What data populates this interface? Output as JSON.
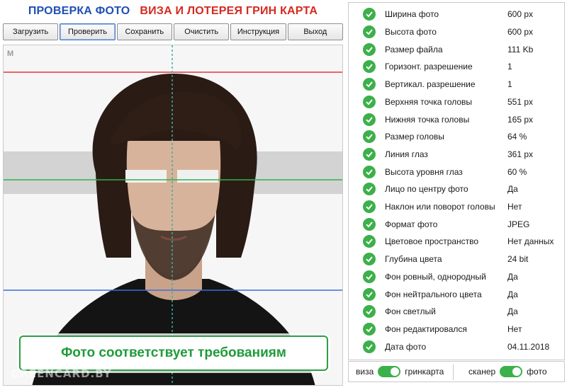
{
  "header": {
    "title_left": "ПРОВЕРКА ФОТО",
    "title_right": "ВИЗА И ЛОТЕРЕЯ ГРИН КАРТА"
  },
  "toolbar": {
    "buttons": [
      "Загрузить",
      "Проверить",
      "Сохранить",
      "Очистить",
      "Инструкция",
      "Выход"
    ]
  },
  "photo": {
    "corner_label": "M",
    "result": "Фото соответствует требованиям",
    "watermark": "GREENCARD.BY"
  },
  "checks": [
    {
      "label": "Ширина фото",
      "value": "600 px"
    },
    {
      "label": "Высота фото",
      "value": "600 px"
    },
    {
      "label": "Размер файла",
      "value": "111 Kb"
    },
    {
      "label": "Горизонт. разрешение",
      "value": "1"
    },
    {
      "label": "Вертикал. разрешение",
      "value": "1"
    },
    {
      "label": "Верхняя точка головы",
      "value": "551 px"
    },
    {
      "label": "Нижняя точка головы",
      "value": "165 px"
    },
    {
      "label": "Размер головы",
      "value": "64 %"
    },
    {
      "label": "Линия глаз",
      "value": "361 px"
    },
    {
      "label": "Высота уровня глаз",
      "value": "60 %"
    },
    {
      "label": "Лицо по центру фото",
      "value": "Да"
    },
    {
      "label": "Наклон или поворот головы",
      "value": "Нет"
    },
    {
      "label": "Формат фото",
      "value": "JPEG"
    },
    {
      "label": "Цветовое пространство",
      "value": "Нет данных"
    },
    {
      "label": "Глубина цвета",
      "value": "24 bit"
    },
    {
      "label": "Фон ровный, однородный",
      "value": "Да"
    },
    {
      "label": "Фон нейтрального цвета",
      "value": "Да"
    },
    {
      "label": "Фон светлый",
      "value": "Да"
    },
    {
      "label": "Фон редактировался",
      "value": "Нет"
    },
    {
      "label": "Дата фото",
      "value": "04.11.2018"
    }
  ],
  "toggles": {
    "left_off": "виза",
    "left_on": "гринкарта",
    "right_off": "сканер",
    "right_on": "фото"
  },
  "colors": {
    "ok_green": "#3cb04a",
    "title_blue": "#1f4fb4",
    "title_red": "#d42a1f",
    "guide_red": "#e0363a",
    "guide_green": "#2fb24a",
    "guide_blue": "#3a6fd8"
  }
}
